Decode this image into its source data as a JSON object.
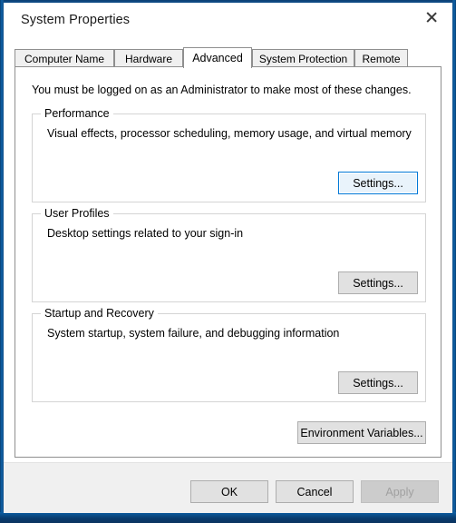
{
  "window": {
    "title": "System Properties",
    "close_icon": "close-icon",
    "accent_color": "#0078d7",
    "frame_color": "#0b5ca8",
    "footer_bg": "#f0f0f0"
  },
  "tabs": [
    {
      "label": "Computer Name",
      "selected": false
    },
    {
      "label": "Hardware",
      "selected": false
    },
    {
      "label": "Advanced",
      "selected": true
    },
    {
      "label": "System Protection",
      "selected": false
    },
    {
      "label": "Remote",
      "selected": false
    }
  ],
  "page": {
    "intro": "You must be logged on as an Administrator to make most of these changes.",
    "groups": [
      {
        "legend": "Performance",
        "description": "Visual effects, processor scheduling, memory usage, and virtual memory",
        "button_label": "Settings...",
        "button_focused": true
      },
      {
        "legend": "User Profiles",
        "description": "Desktop settings related to your sign-in",
        "button_label": "Settings...",
        "button_focused": false
      },
      {
        "legend": "Startup and Recovery",
        "description": "System startup, system failure, and debugging information",
        "button_label": "Settings...",
        "button_focused": false
      }
    ],
    "environment_variables_label": "Environment Variables..."
  },
  "footer": {
    "ok_label": "OK",
    "cancel_label": "Cancel",
    "apply_label": "Apply",
    "apply_disabled": true
  }
}
